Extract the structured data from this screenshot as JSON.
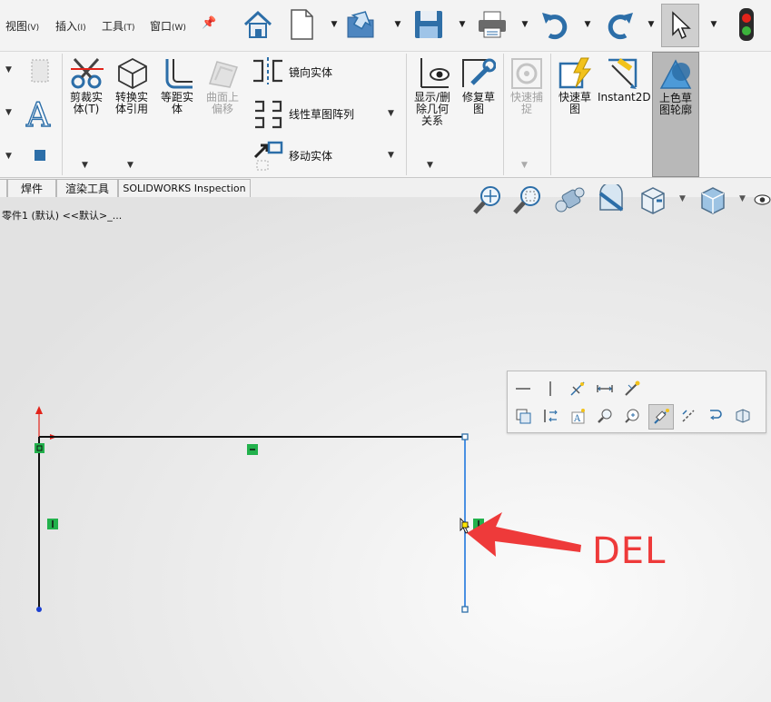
{
  "menu": {
    "items": [
      {
        "label": "视图",
        "key": "(V)"
      },
      {
        "label": "插入",
        "key": "(I)"
      },
      {
        "label": "工具",
        "key": "(T)"
      },
      {
        "label": "窗口",
        "key": "(W)"
      }
    ]
  },
  "quick_access": [
    "home-icon",
    "new-document-icon",
    "open-icon",
    "save-icon",
    "print-icon",
    "undo-icon",
    "redo-icon",
    "select-icon",
    "rebuild-icon"
  ],
  "ribbon": {
    "trim": "剪裁实\n体(T)",
    "convert": "转换实\n体引用",
    "offset": "等距实\n体",
    "surface_offset": "曲面上\n偏移",
    "mirror": "镜向实体",
    "linear_pattern": "线性草图阵列",
    "move": "移动实体",
    "display_relations": "显示/删\n除几何\n关系",
    "repair": "修复草\n图",
    "quick_snaps": "快速捕\n捉",
    "rapid_sketch": "快速草\n图",
    "instant2d": "Instant2D",
    "shaded_contours": "上色草\n图轮廓"
  },
  "tabs": [
    "焊件",
    "渲染工具",
    "SOLIDWORKS Inspection"
  ],
  "feature_tree": {
    "label": "零件1 (默认) <<默认>_..."
  },
  "colors": {
    "accent_red": "#ee3a3a",
    "selected_blue": "#4a90e2",
    "relation_green": "#22b14c"
  },
  "context_toolbar": {
    "row1": [
      "horizontal-icon",
      "vertical-icon",
      "fix-icon",
      "equal-icon",
      "smart-dimension-icon"
    ],
    "row2": [
      "copy-icon",
      "mirror-relation-icon",
      "text-icon",
      "zoom-selection-icon",
      "zoom-fit-icon",
      "edit-selection-icon",
      "construction-geometry-icon",
      "trim-icon",
      "3d-view-icon"
    ]
  },
  "annotation": {
    "text": "DEL"
  }
}
